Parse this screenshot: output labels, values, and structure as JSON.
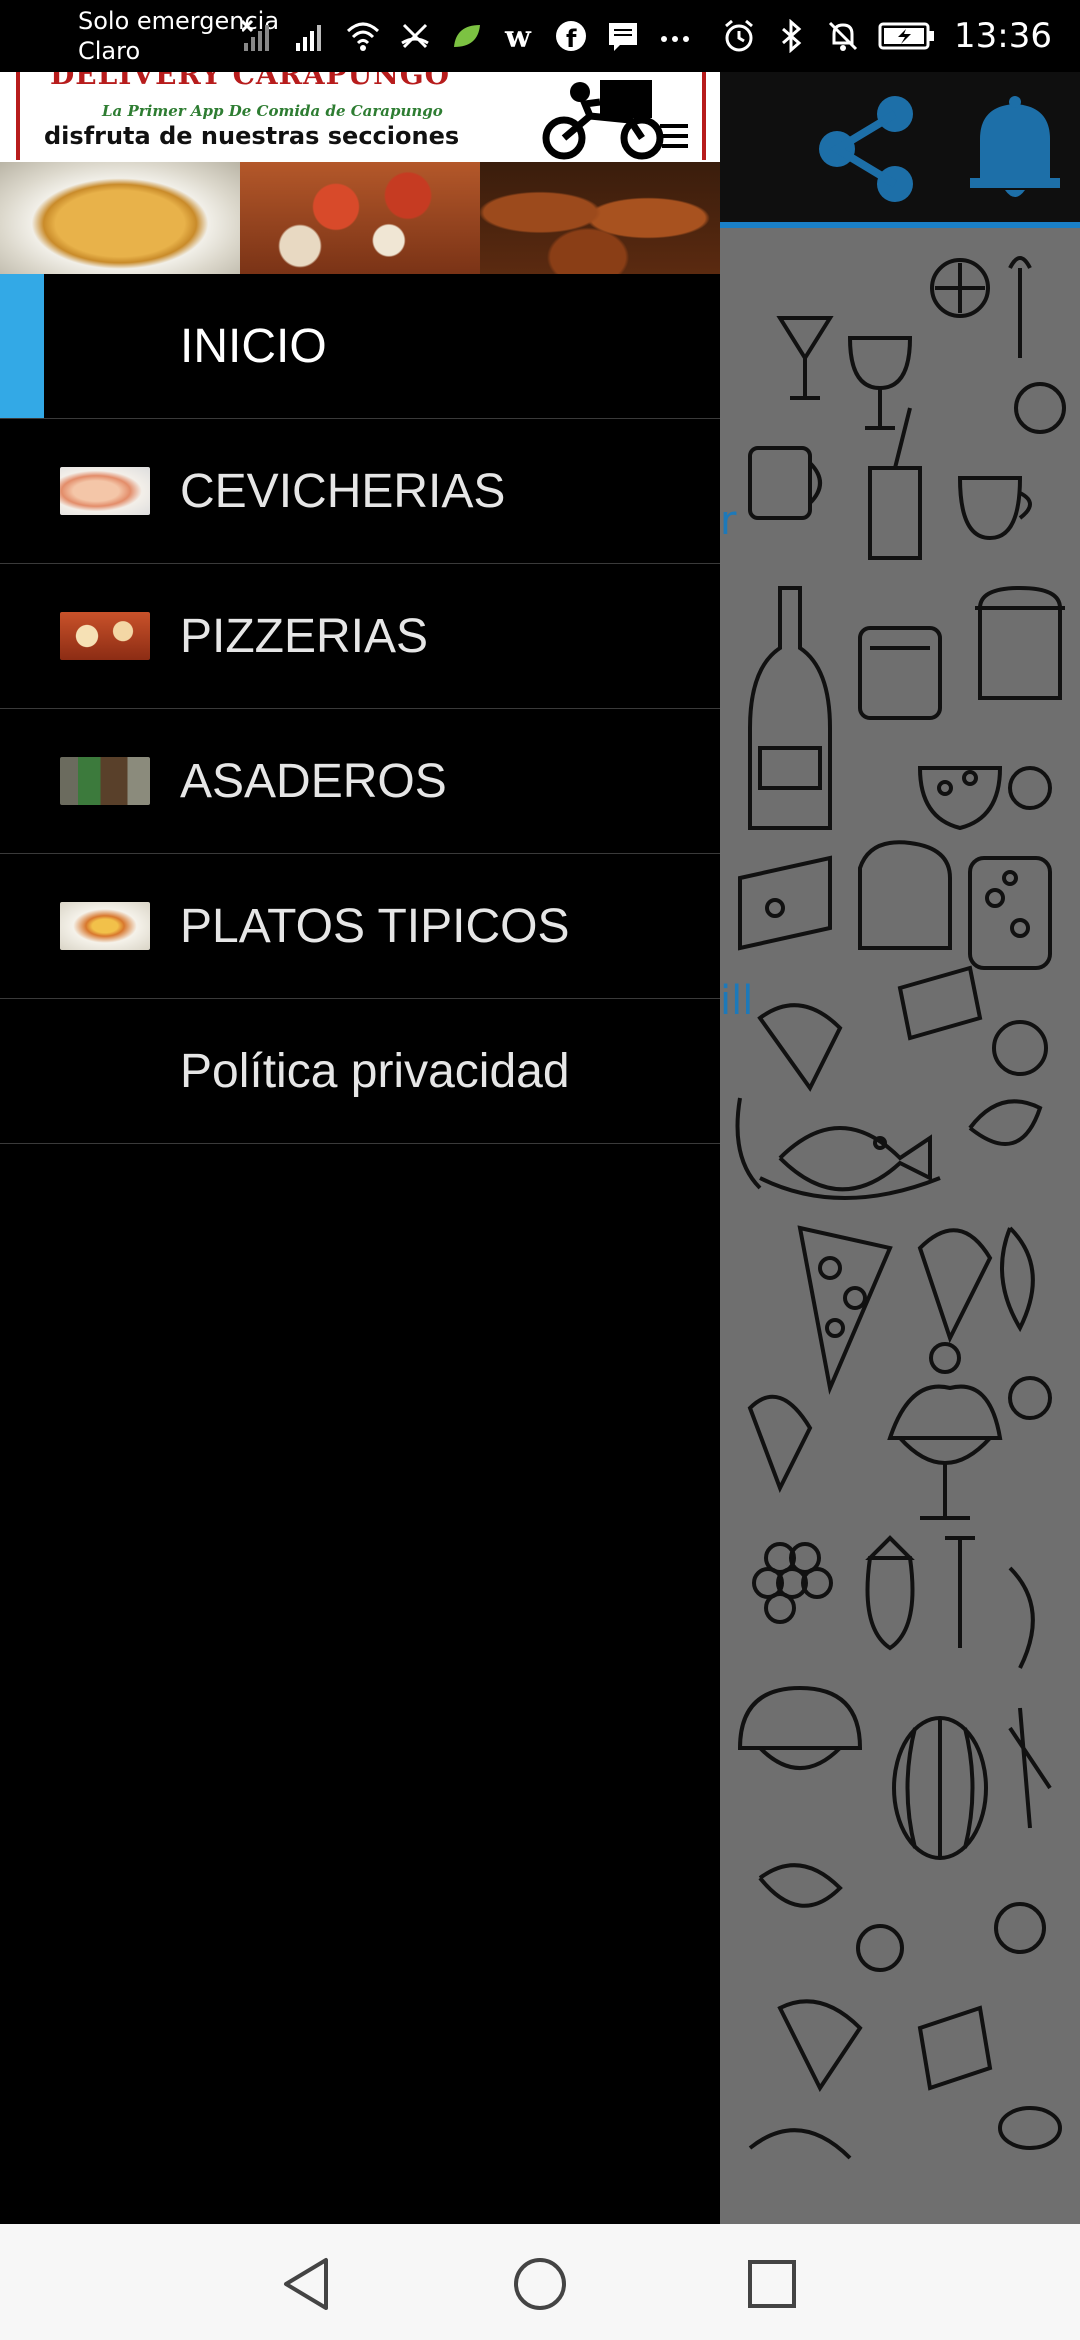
{
  "status_bar": {
    "carrier_line1": "Solo emergencia",
    "carrier_line2": "Claro",
    "time": "13:36",
    "icons": [
      "signal-off-icon",
      "signal-icon",
      "wifi-icon",
      "call-icon",
      "leaf-icon",
      "w-icon",
      "facebook-icon",
      "message-icon",
      "more-icon",
      "alarm-icon",
      "bluetooth-icon",
      "mute-icon",
      "battery-charging-icon"
    ]
  },
  "banner": {
    "brand": "DELIVERY CARAPUNGO",
    "subtitle": "La Primer App De Comida de Carapungo",
    "slogan": "disfruta de nuestras secciones"
  },
  "menu": {
    "items": [
      {
        "label": "INICIO",
        "active": true,
        "thumb": ""
      },
      {
        "label": "CEVICHERIAS",
        "active": false,
        "thumb": "ceviche"
      },
      {
        "label": "PIZZERIAS",
        "active": false,
        "thumb": "pizza"
      },
      {
        "label": "ASADEROS",
        "active": false,
        "thumb": "grill"
      },
      {
        "label": "PLATOS TIPICOS",
        "active": false,
        "thumb": "typical-dish"
      },
      {
        "label": "Política privacidad",
        "active": false,
        "thumb": ""
      }
    ]
  },
  "background_app": {
    "toolbar_icons": [
      "share-icon",
      "bell-icon"
    ],
    "fragment_1": "r",
    "fragment_2": "ill"
  },
  "colors": {
    "accent": "#33a9e6",
    "toolbar_line": "#1a7fc6",
    "brand_red": "#b71c1c",
    "brand_green": "#2e7d32"
  },
  "nav_bar": {
    "buttons": [
      "back-icon",
      "home-icon",
      "recents-icon"
    ]
  }
}
